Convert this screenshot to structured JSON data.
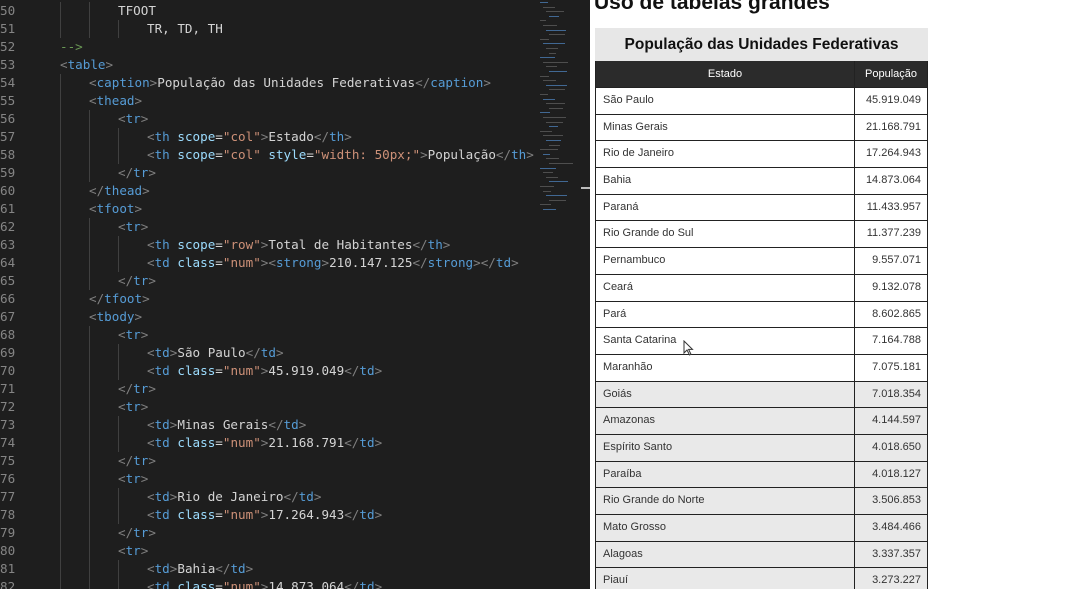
{
  "editor": {
    "lines": [
      {
        "n": "50",
        "indent": 2,
        "tokens": [
          [
            "txt",
            "TFOOT"
          ]
        ]
      },
      {
        "n": "51",
        "indent": 3,
        "tokens": [
          [
            "txt",
            "TR, TD, TH"
          ]
        ]
      },
      {
        "n": "52",
        "indent": 0,
        "tokens": [
          [
            "cm",
            "-->"
          ]
        ]
      },
      {
        "n": "53",
        "indent": 0,
        "tokens": [
          [
            "br",
            "<"
          ],
          [
            "tag",
            "table"
          ],
          [
            "br",
            ">"
          ]
        ]
      },
      {
        "n": "54",
        "indent": 1,
        "tokens": [
          [
            "br",
            "<"
          ],
          [
            "tag",
            "caption"
          ],
          [
            "br",
            ">"
          ],
          [
            "txt",
            "População das Unidades Federativas"
          ],
          [
            "br",
            "</"
          ],
          [
            "tag",
            "caption"
          ],
          [
            "br",
            ">"
          ]
        ]
      },
      {
        "n": "55",
        "indent": 1,
        "tokens": [
          [
            "br",
            "<"
          ],
          [
            "tag",
            "thead"
          ],
          [
            "br",
            ">"
          ]
        ]
      },
      {
        "n": "56",
        "indent": 2,
        "tokens": [
          [
            "br",
            "<"
          ],
          [
            "tag",
            "tr"
          ],
          [
            "br",
            ">"
          ]
        ]
      },
      {
        "n": "57",
        "indent": 3,
        "tokens": [
          [
            "br",
            "<"
          ],
          [
            "tag",
            "th"
          ],
          [
            "txt",
            " "
          ],
          [
            "attr",
            "scope"
          ],
          [
            "txt",
            "="
          ],
          [
            "str",
            "\"col\""
          ],
          [
            "br",
            ">"
          ],
          [
            "txt",
            "Estado"
          ],
          [
            "br",
            "</"
          ],
          [
            "tag",
            "th"
          ],
          [
            "br",
            ">"
          ]
        ]
      },
      {
        "n": "58",
        "indent": 3,
        "tokens": [
          [
            "br",
            "<"
          ],
          [
            "tag",
            "th"
          ],
          [
            "txt",
            " "
          ],
          [
            "attr",
            "scope"
          ],
          [
            "txt",
            "="
          ],
          [
            "str",
            "\"col\""
          ],
          [
            "txt",
            " "
          ],
          [
            "attr",
            "style"
          ],
          [
            "txt",
            "="
          ],
          [
            "str",
            "\"width: 50px;\""
          ],
          [
            "br",
            ">"
          ],
          [
            "txt",
            "População"
          ],
          [
            "br",
            "</"
          ],
          [
            "tag",
            "th"
          ],
          [
            "br",
            ">"
          ]
        ]
      },
      {
        "n": "59",
        "indent": 2,
        "tokens": [
          [
            "br",
            "</"
          ],
          [
            "tag",
            "tr"
          ],
          [
            "br",
            ">"
          ]
        ]
      },
      {
        "n": "60",
        "indent": 1,
        "tokens": [
          [
            "br",
            "</"
          ],
          [
            "tag",
            "thead"
          ],
          [
            "br",
            ">"
          ]
        ]
      },
      {
        "n": "61",
        "indent": 1,
        "tokens": [
          [
            "br",
            "<"
          ],
          [
            "tag",
            "tfoot"
          ],
          [
            "br",
            ">"
          ]
        ]
      },
      {
        "n": "62",
        "indent": 2,
        "tokens": [
          [
            "br",
            "<"
          ],
          [
            "tag",
            "tr"
          ],
          [
            "br",
            ">"
          ]
        ]
      },
      {
        "n": "63",
        "indent": 3,
        "tokens": [
          [
            "br",
            "<"
          ],
          [
            "tag",
            "th"
          ],
          [
            "txt",
            " "
          ],
          [
            "attr",
            "scope"
          ],
          [
            "txt",
            "="
          ],
          [
            "str",
            "\"row\""
          ],
          [
            "br",
            ">"
          ],
          [
            "txt",
            "Total de Habitantes"
          ],
          [
            "br",
            "</"
          ],
          [
            "tag",
            "th"
          ],
          [
            "br",
            ">"
          ]
        ]
      },
      {
        "n": "64",
        "indent": 3,
        "tokens": [
          [
            "br",
            "<"
          ],
          [
            "tag",
            "td"
          ],
          [
            "txt",
            " "
          ],
          [
            "attr",
            "class"
          ],
          [
            "txt",
            "="
          ],
          [
            "str",
            "\"num\""
          ],
          [
            "br",
            "><"
          ],
          [
            "tag",
            "strong"
          ],
          [
            "br",
            ">"
          ],
          [
            "txt",
            "210.147.125"
          ],
          [
            "br",
            "</"
          ],
          [
            "tag",
            "strong"
          ],
          [
            "br",
            "></"
          ],
          [
            "tag",
            "td"
          ],
          [
            "br",
            ">"
          ]
        ]
      },
      {
        "n": "65",
        "indent": 2,
        "tokens": [
          [
            "br",
            "</"
          ],
          [
            "tag",
            "tr"
          ],
          [
            "br",
            ">"
          ]
        ]
      },
      {
        "n": "66",
        "indent": 1,
        "tokens": [
          [
            "br",
            "</"
          ],
          [
            "tag",
            "tfoot"
          ],
          [
            "br",
            ">"
          ]
        ]
      },
      {
        "n": "67",
        "indent": 1,
        "tokens": [
          [
            "br",
            "<"
          ],
          [
            "tag",
            "tbody"
          ],
          [
            "br",
            ">"
          ]
        ]
      },
      {
        "n": "68",
        "indent": 2,
        "tokens": [
          [
            "br",
            "<"
          ],
          [
            "tag",
            "tr"
          ],
          [
            "br",
            ">"
          ]
        ]
      },
      {
        "n": "69",
        "indent": 3,
        "tokens": [
          [
            "br",
            "<"
          ],
          [
            "tag",
            "td"
          ],
          [
            "br",
            ">"
          ],
          [
            "txt",
            "São Paulo"
          ],
          [
            "br",
            "</"
          ],
          [
            "tag",
            "td"
          ],
          [
            "br",
            ">"
          ]
        ]
      },
      {
        "n": "70",
        "indent": 3,
        "tokens": [
          [
            "br",
            "<"
          ],
          [
            "tag",
            "td"
          ],
          [
            "txt",
            " "
          ],
          [
            "attr",
            "class"
          ],
          [
            "txt",
            "="
          ],
          [
            "str",
            "\"num\""
          ],
          [
            "br",
            ">"
          ],
          [
            "txt",
            "45.919.049"
          ],
          [
            "br",
            "</"
          ],
          [
            "tag",
            "td"
          ],
          [
            "br",
            ">"
          ]
        ]
      },
      {
        "n": "71",
        "indent": 2,
        "tokens": [
          [
            "br",
            "</"
          ],
          [
            "tag",
            "tr"
          ],
          [
            "br",
            ">"
          ]
        ]
      },
      {
        "n": "72",
        "indent": 2,
        "tokens": [
          [
            "br",
            "<"
          ],
          [
            "tag",
            "tr"
          ],
          [
            "br",
            ">"
          ]
        ]
      },
      {
        "n": "73",
        "indent": 3,
        "tokens": [
          [
            "br",
            "<"
          ],
          [
            "tag",
            "td"
          ],
          [
            "br",
            ">"
          ],
          [
            "txt",
            "Minas Gerais"
          ],
          [
            "br",
            "</"
          ],
          [
            "tag",
            "td"
          ],
          [
            "br",
            ">"
          ]
        ]
      },
      {
        "n": "74",
        "indent": 3,
        "tokens": [
          [
            "br",
            "<"
          ],
          [
            "tag",
            "td"
          ],
          [
            "txt",
            " "
          ],
          [
            "attr",
            "class"
          ],
          [
            "txt",
            "="
          ],
          [
            "str",
            "\"num\""
          ],
          [
            "br",
            ">"
          ],
          [
            "txt",
            "21.168.791"
          ],
          [
            "br",
            "</"
          ],
          [
            "tag",
            "td"
          ],
          [
            "br",
            ">"
          ]
        ]
      },
      {
        "n": "75",
        "indent": 2,
        "tokens": [
          [
            "br",
            "</"
          ],
          [
            "tag",
            "tr"
          ],
          [
            "br",
            ">"
          ]
        ]
      },
      {
        "n": "76",
        "indent": 2,
        "tokens": [
          [
            "br",
            "<"
          ],
          [
            "tag",
            "tr"
          ],
          [
            "br",
            ">"
          ]
        ]
      },
      {
        "n": "77",
        "indent": 3,
        "tokens": [
          [
            "br",
            "<"
          ],
          [
            "tag",
            "td"
          ],
          [
            "br",
            ">"
          ],
          [
            "txt",
            "Rio de Janeiro"
          ],
          [
            "br",
            "</"
          ],
          [
            "tag",
            "td"
          ],
          [
            "br",
            ">"
          ]
        ]
      },
      {
        "n": "78",
        "indent": 3,
        "tokens": [
          [
            "br",
            "<"
          ],
          [
            "tag",
            "td"
          ],
          [
            "txt",
            " "
          ],
          [
            "attr",
            "class"
          ],
          [
            "txt",
            "="
          ],
          [
            "str",
            "\"num\""
          ],
          [
            "br",
            ">"
          ],
          [
            "txt",
            "17.264.943"
          ],
          [
            "br",
            "</"
          ],
          [
            "tag",
            "td"
          ],
          [
            "br",
            ">"
          ]
        ]
      },
      {
        "n": "79",
        "indent": 2,
        "tokens": [
          [
            "br",
            "</"
          ],
          [
            "tag",
            "tr"
          ],
          [
            "br",
            ">"
          ]
        ]
      },
      {
        "n": "80",
        "indent": 2,
        "tokens": [
          [
            "br",
            "<"
          ],
          [
            "tag",
            "tr"
          ],
          [
            "br",
            ">"
          ]
        ]
      },
      {
        "n": "81",
        "indent": 3,
        "tokens": [
          [
            "br",
            "<"
          ],
          [
            "tag",
            "td"
          ],
          [
            "br",
            ">"
          ],
          [
            "txt",
            "Bahia"
          ],
          [
            "br",
            "</"
          ],
          [
            "tag",
            "td"
          ],
          [
            "br",
            ">"
          ]
        ]
      },
      {
        "n": "82",
        "indent": 3,
        "tokens": [
          [
            "br",
            "<"
          ],
          [
            "tag",
            "td"
          ],
          [
            "txt",
            " "
          ],
          [
            "attr",
            "class"
          ],
          [
            "txt",
            "="
          ],
          [
            "str",
            "\"num\""
          ],
          [
            "br",
            ">"
          ],
          [
            "txt",
            "14.873.064"
          ],
          [
            "br",
            "</"
          ],
          [
            "tag",
            "td"
          ],
          [
            "br",
            ">"
          ]
        ]
      }
    ]
  },
  "preview": {
    "heading": "Uso de tabelas grandes",
    "caption": "População das Unidades Federativas",
    "columns": [
      "Estado",
      "População"
    ],
    "rows": [
      [
        "São Paulo",
        "45.919.049"
      ],
      [
        "Minas Gerais",
        "21.168.791"
      ],
      [
        "Rio de Janeiro",
        "17.264.943"
      ],
      [
        "Bahia",
        "14.873.064"
      ],
      [
        "Paraná",
        "11.433.957"
      ],
      [
        "Rio Grande do Sul",
        "11.377.239"
      ],
      [
        "Pernambuco",
        "9.557.071"
      ],
      [
        "Ceará",
        "9.132.078"
      ],
      [
        "Pará",
        "8.602.865"
      ],
      [
        "Santa Catarina",
        "7.164.788"
      ],
      [
        "Maranhão",
        "7.075.181"
      ],
      [
        "Goiás",
        "7.018.354"
      ],
      [
        "Amazonas",
        "4.144.597"
      ],
      [
        "Espírito Santo",
        "4.018.650"
      ],
      [
        "Paraíba",
        "4.018.127"
      ],
      [
        "Rio Grande do Norte",
        "3.506.853"
      ],
      [
        "Mato Grosso",
        "3.484.466"
      ],
      [
        "Alagoas",
        "3.337.357"
      ],
      [
        "Piauí",
        "3.273.227"
      ]
    ]
  },
  "colors": {
    "editor_bg": "#1e1e1e",
    "tag": "#569cd6",
    "attr": "#9cdcfe",
    "string": "#ce9178",
    "comment": "#6a9955",
    "table_header_bg": "#2b2b2b"
  }
}
